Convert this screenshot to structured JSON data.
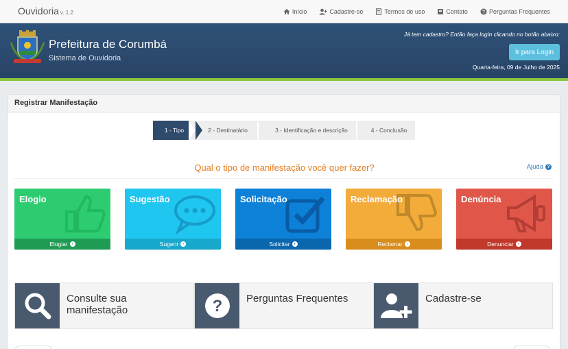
{
  "topnav": {
    "brand": "Ouvidoria",
    "version": "v. 1.2",
    "links": [
      {
        "label": "Início",
        "icon": "home-icon"
      },
      {
        "label": "Cadastre-se",
        "icon": "user-plus-icon"
      },
      {
        "label": "Termos de uso",
        "icon": "document-icon"
      },
      {
        "label": "Contato",
        "icon": "phone-book-icon"
      },
      {
        "label": "Perguntas Frequentes",
        "icon": "question-circle-icon"
      }
    ]
  },
  "header": {
    "title": "Prefeitura de Corumbá",
    "subtitle": "Sistema de Ouvidoria",
    "login_prompt": "Já tem cadastro? Então faça login clicando no botão abaixo:",
    "login_button": "Ir para Login",
    "date": "Quarta-feira, 09 de Julho de 2025"
  },
  "panel": {
    "title": "Registrar Manifestação",
    "steps": [
      "1 - Tipo",
      "2 - Destinatário",
      "3 - Identificação e descrição",
      "4 - Conclusão"
    ],
    "question": "Qual o tipo de manifestação você quer fazer?",
    "help": "Ajuda"
  },
  "cards": [
    {
      "title": "Elogio",
      "action": "Elogiar",
      "color": "#2ecc71",
      "foot": "#1f9c54",
      "icon": "thumbs-up-icon"
    },
    {
      "title": "Sugestão",
      "action": "Sugerir",
      "color": "#1fc6f0",
      "foot": "#18a8cc",
      "icon": "speech-bubble-icon"
    },
    {
      "title": "Solicitação",
      "action": "Solicitar",
      "color": "#0d80d8",
      "foot": "#0a66ad",
      "icon": "checkbox-icon"
    },
    {
      "title": "Reclamação",
      "action": "Reclamar",
      "color": "#f3ab3a",
      "foot": "#d98d1c",
      "icon": "thumbs-down-icon"
    },
    {
      "title": "Denúncia",
      "action": "Denunciar",
      "color": "#e0574a",
      "foot": "#c0392b",
      "icon": "megaphone-icon"
    }
  ],
  "tiles": [
    {
      "label": "Consulte sua manifestação",
      "icon": "search-icon"
    },
    {
      "label": "Perguntas Frequentes",
      "icon": "question-icon"
    },
    {
      "label": "Cadastre-se",
      "icon": "user-add-icon"
    }
  ]
}
